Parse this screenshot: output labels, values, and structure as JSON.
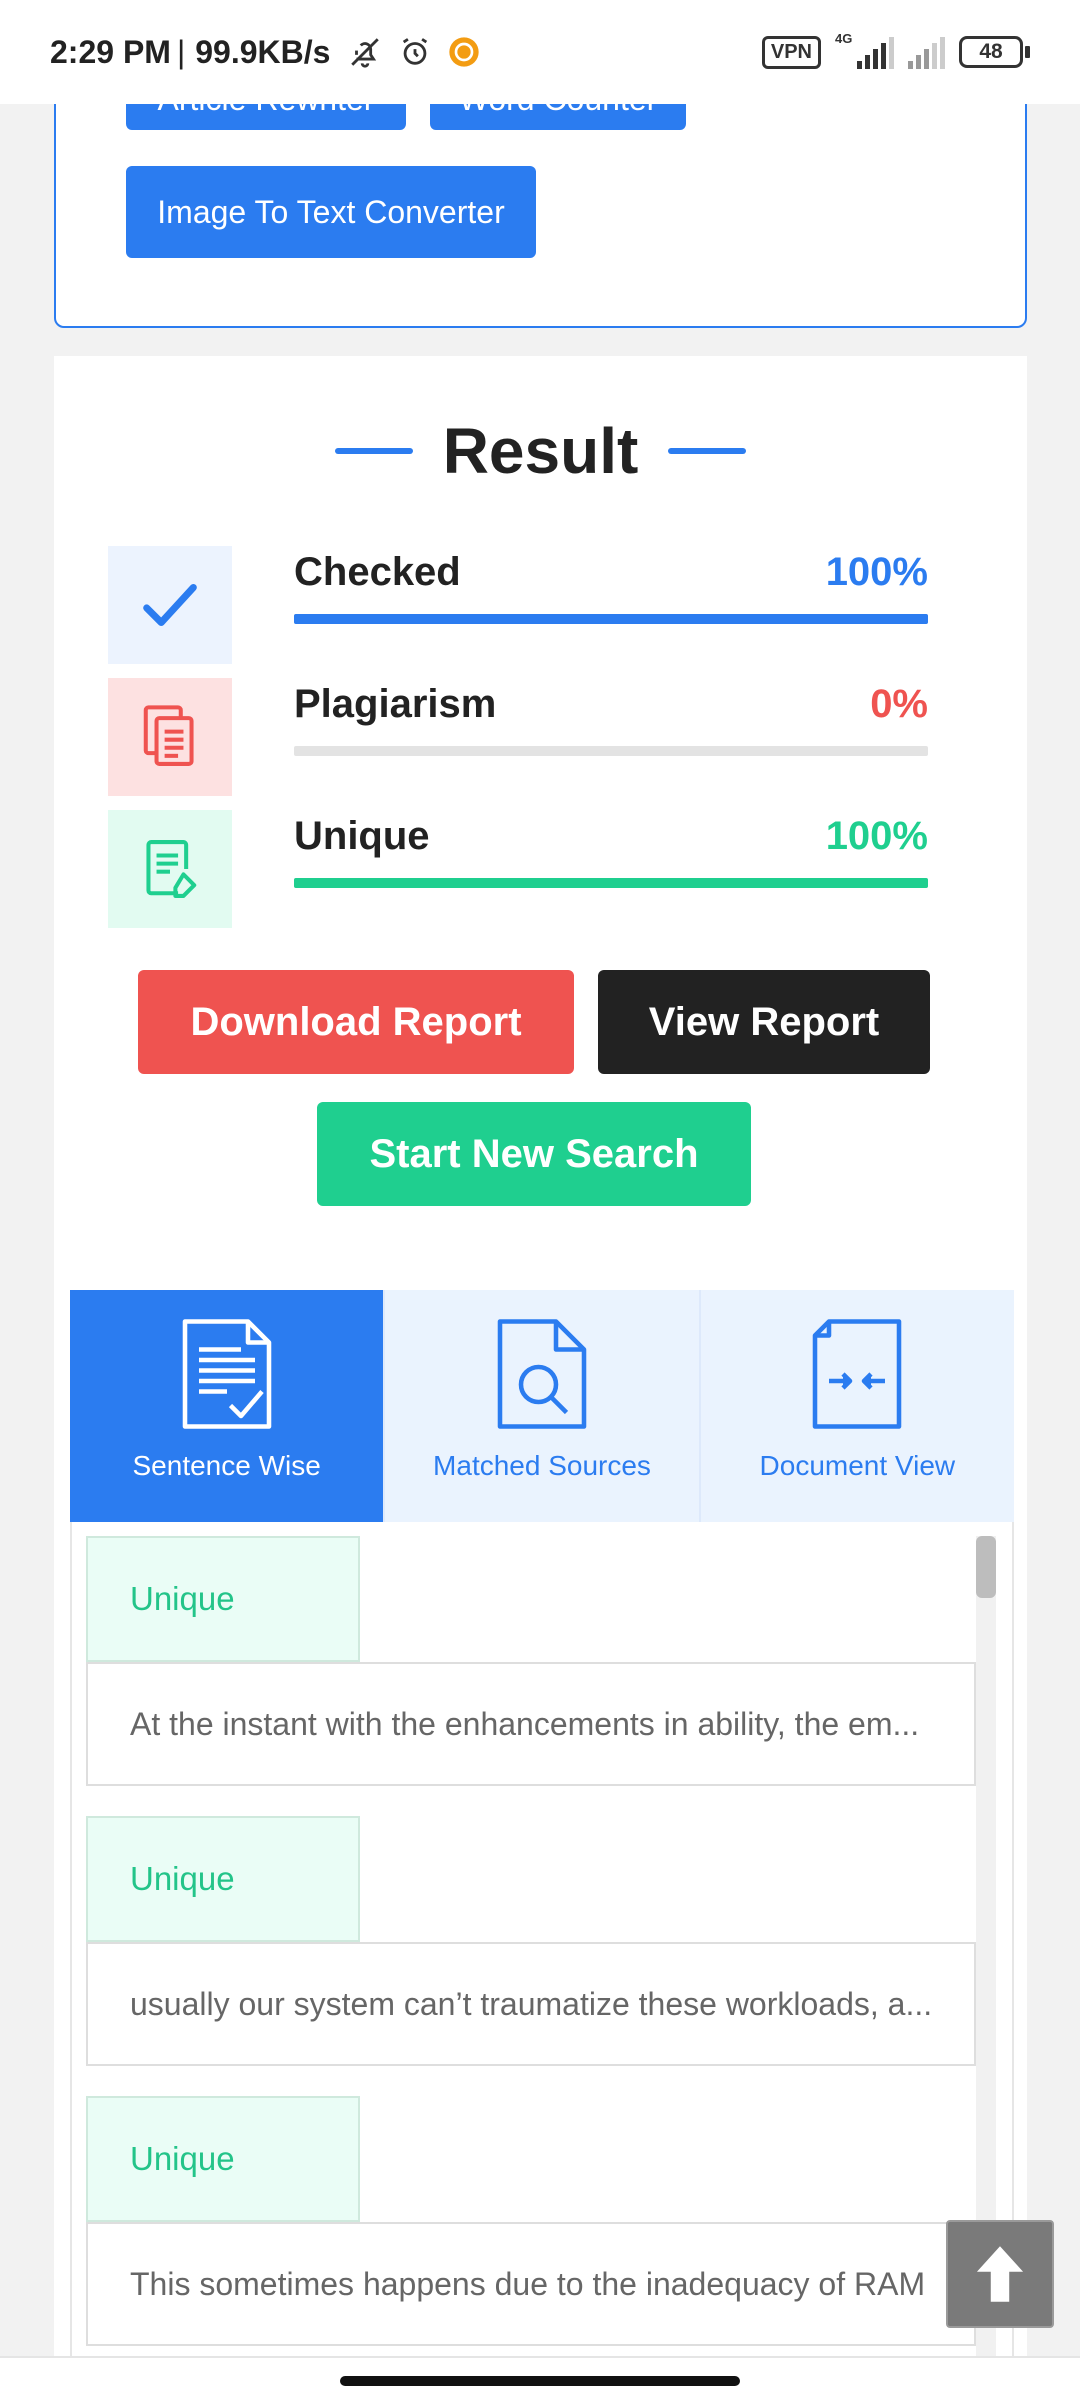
{
  "status_bar": {
    "time": "2:29 PM",
    "separator": "|",
    "speed": "99.9KB/s",
    "vpn": "VPN",
    "network": "4G",
    "battery": "48"
  },
  "tools": {
    "hidden_buttons": [
      "Article Rewriter",
      "Word Counter"
    ],
    "image_to_text_label": "Image To Text Converter"
  },
  "result": {
    "title": "Result",
    "stats": [
      {
        "label": "Checked",
        "value": "100%",
        "percent": 100,
        "color": "#2b7cf0"
      },
      {
        "label": "Plagiarism",
        "value": "0%",
        "percent": 0,
        "color": "#ef5350"
      },
      {
        "label": "Unique",
        "value": "100%",
        "percent": 100,
        "color": "#1fcf8f"
      }
    ],
    "download_label": "Download Report",
    "view_label": "View Report",
    "new_search_label": "Start New Search"
  },
  "tabs": [
    {
      "label": "Sentence Wise",
      "active": true
    },
    {
      "label": "Matched Sources",
      "active": false
    },
    {
      "label": "Document View",
      "active": false
    }
  ],
  "sentences": [
    {
      "tag": "Unique",
      "text": "At the instant with the enhancements in ability, the em..."
    },
    {
      "tag": "Unique",
      "text": "usually our system can’t traumatize these workloads, a..."
    },
    {
      "tag": "Unique",
      "text": "This sometimes happens due to the inadequacy of RAM"
    }
  ],
  "colors": {
    "accent": "#2b7cf0",
    "danger": "#ef5350",
    "success": "#1fcf8f",
    "dark": "#222222"
  }
}
